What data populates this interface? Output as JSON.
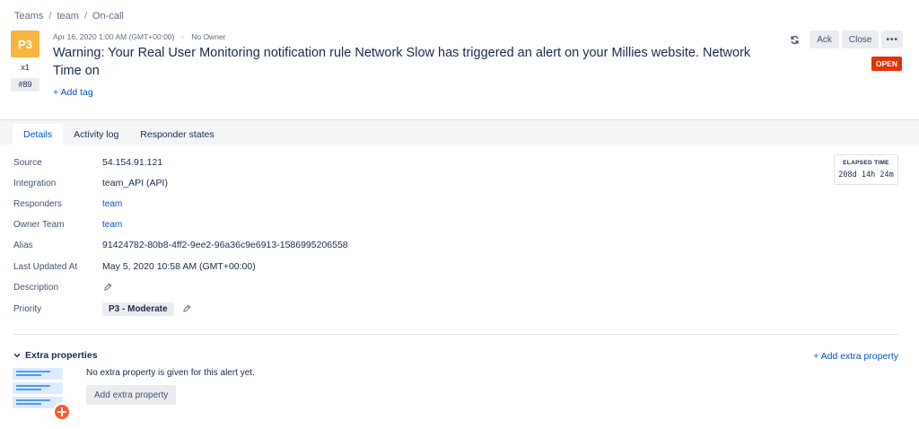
{
  "breadcrumb": [
    {
      "label": "Teams"
    },
    {
      "label": "team"
    },
    {
      "label": "On-call"
    }
  ],
  "breadcrumb_separator": "/",
  "alert": {
    "priority": "P3",
    "count": "x1",
    "tiny_id": "#89",
    "created_at": "Apr 16, 2020 1:00 AM (GMT+00:00)",
    "meta_separator": "·",
    "owner": "No Owner",
    "title": "Warning: Your Real User Monitoring notification rule Network Slow has triggered an alert on your Millies website. Network Time on",
    "add_tag_label": "+ Add tag",
    "status": "OPEN",
    "priority_color": "#f4b63f",
    "status_color": "#de350b"
  },
  "actions": {
    "refresh_icon": "refresh-icon",
    "ack_label": "Ack",
    "close_label": "Close",
    "more_label": "•••"
  },
  "tabs": [
    {
      "label": "Details",
      "active": true
    },
    {
      "label": "Activity log",
      "active": false
    },
    {
      "label": "Responder states",
      "active": false
    }
  ],
  "details": {
    "source": {
      "label": "Source",
      "value": "54.154.91.121"
    },
    "integration": {
      "label": "Integration",
      "value": "team_API (API)"
    },
    "responders": {
      "label": "Responders",
      "value": "team"
    },
    "owner_team": {
      "label": "Owner Team",
      "value": "team"
    },
    "alias": {
      "label": "Alias",
      "value": "91424782-80b8-4ff2-9ee2-96a36c9e6913-1586995206558"
    },
    "last_updated": {
      "label": "Last Updated At",
      "value": "May 5, 2020 10:58 AM (GMT+00:00)"
    },
    "description": {
      "label": "Description"
    },
    "priority": {
      "label": "Priority",
      "value": "P3 - Moderate"
    }
  },
  "elapsed": {
    "heading": "ELAPSED TIME",
    "value": "208d  14h 24m"
  },
  "extra_properties": {
    "heading": "Extra properties",
    "add_link_label": "+ Add extra property",
    "empty_message": "No extra property is given for this alert yet.",
    "add_button_label": "Add extra property"
  },
  "colors": {
    "link": "#0052cc",
    "text": "#172b4d",
    "muted": "#5e6c84",
    "button_bg": "#ebecf0"
  }
}
